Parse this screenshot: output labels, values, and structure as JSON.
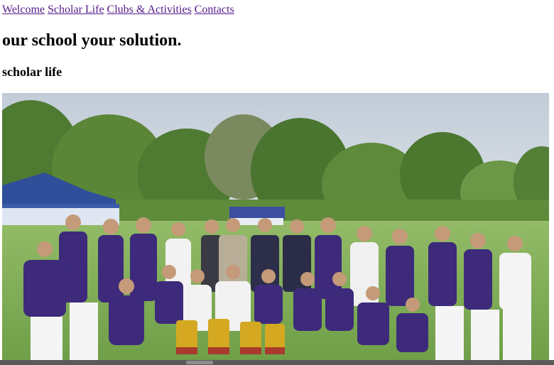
{
  "nav": {
    "links": [
      "Welcome",
      "Scholar Life",
      "Clubs & Activities",
      "Contacts"
    ]
  },
  "hero": {
    "tagline": "our school your solution."
  },
  "section": {
    "title": "scholar life"
  },
  "colors": {
    "link": "#551a8b",
    "blazer": "#3d2a7a",
    "grass": "#7fae55",
    "sky": "#c9d3dd",
    "scrollbar_track": "#5a5a5a",
    "scrollbar_thumb": "#8e8e8e"
  }
}
